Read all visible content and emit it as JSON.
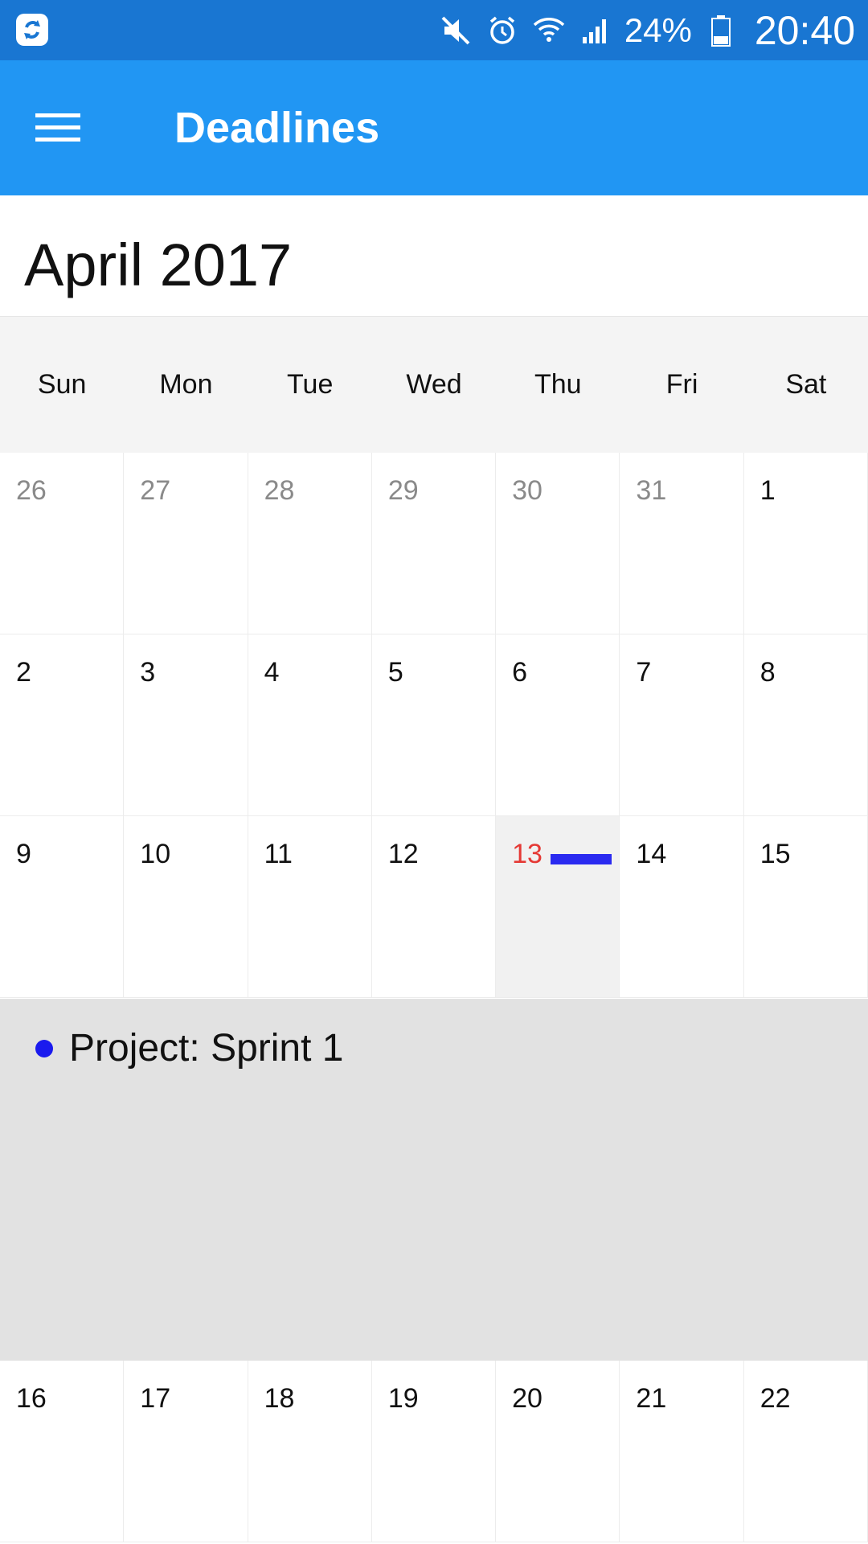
{
  "status_bar": {
    "battery_percent": "24%",
    "time": "20:40",
    "icons": [
      "sync-app-icon",
      "mute-icon",
      "alarm-icon",
      "wifi-icon",
      "signal-icon",
      "battery-icon"
    ]
  },
  "app_bar": {
    "title": "Deadlines",
    "menu_icon": "hamburger-menu-icon"
  },
  "calendar": {
    "month_title": "April 2017",
    "weekdays": [
      "Sun",
      "Mon",
      "Tue",
      "Wed",
      "Thu",
      "Fri",
      "Sat"
    ],
    "weeks": [
      [
        "26",
        "27",
        "28",
        "29",
        "30",
        "31",
        "1"
      ],
      [
        "2",
        "3",
        "4",
        "5",
        "6",
        "7",
        "8"
      ],
      [
        "9",
        "10",
        "11",
        "12",
        "13",
        "14",
        "15"
      ],
      [
        "16",
        "17",
        "18",
        "19",
        "20",
        "21",
        "22"
      ]
    ],
    "today": "13"
  },
  "events": {
    "items": [
      {
        "label": "Project: Sprint 1",
        "color": "#1a1aee"
      }
    ]
  },
  "colors": {
    "status_bar": "#1976D2",
    "app_bar": "#2196F3",
    "today_text": "#e53935",
    "event": "#2a2af0"
  }
}
